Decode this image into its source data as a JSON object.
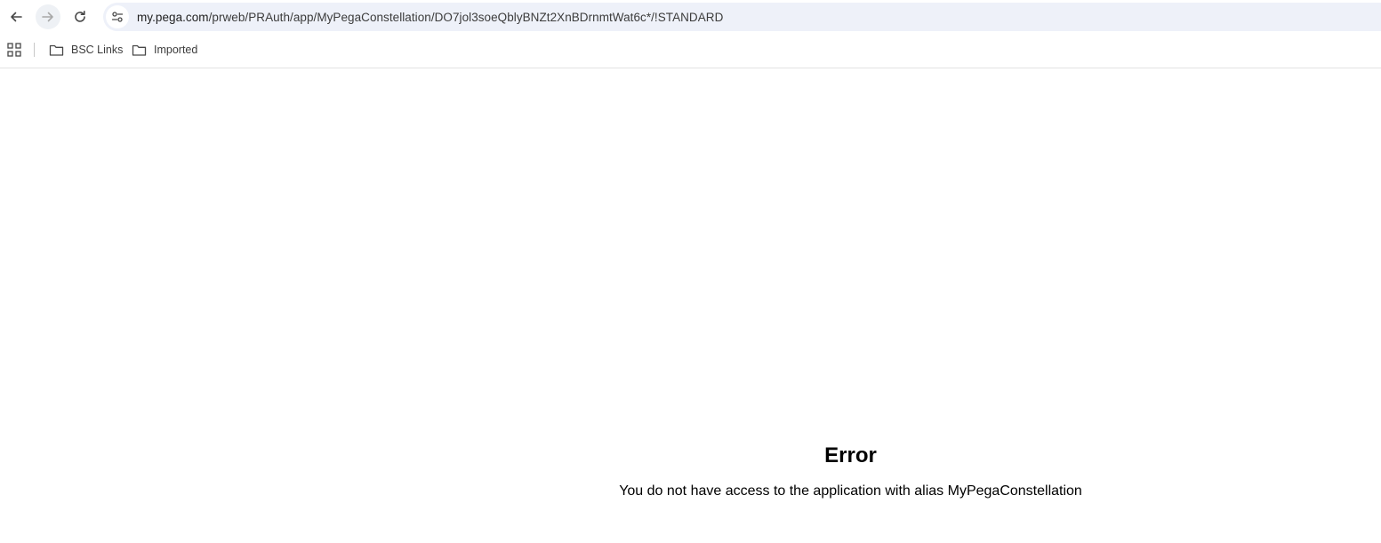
{
  "browser": {
    "url_host": "my.pega.com",
    "url_path": "/prweb/PRAuth/app/MyPegaConstellation/DO7jol3soeQblyBNZt2XnBDrnmtWat6c*/!STANDARD"
  },
  "bookmarks": [
    {
      "label": "BSC Links"
    },
    {
      "label": "Imported"
    }
  ],
  "icons": {
    "back": "arrow-left",
    "forward": "arrow-right",
    "reload": "reload",
    "site_info": "tune",
    "apps": "grid",
    "bookmark_folder": "folder"
  },
  "page": {
    "error_title": "Error",
    "error_message": "You do not have access to the application with alias MyPegaConstellation"
  }
}
